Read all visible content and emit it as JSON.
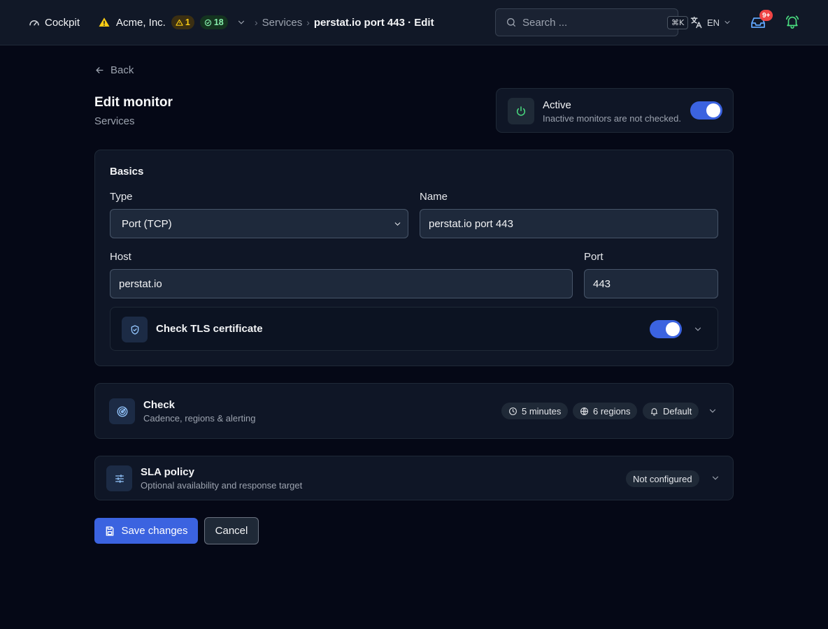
{
  "topbar": {
    "brand_label": "Cockpit",
    "org_name": "Acme, Inc.",
    "warning_count": "1",
    "ok_count": "18",
    "breadcrumb": {
      "parent": "Services",
      "current": "perstat.io port 443 · Edit"
    },
    "search": {
      "placeholder": "Search ...",
      "shortcut": "⌘K"
    },
    "language": "EN",
    "inbox_badge": "9+"
  },
  "page": {
    "back_label": "Back",
    "title": "Edit monitor",
    "subtitle": "Services"
  },
  "active_card": {
    "title": "Active",
    "description": "Inactive monitors are not checked.",
    "enabled": true
  },
  "basics": {
    "title": "Basics",
    "type_label": "Type",
    "type_value": "Port (TCP)",
    "name_label": "Name",
    "name_value": "perstat.io port 443",
    "host_label": "Host",
    "host_value": "perstat.io",
    "port_label": "Port",
    "port_value": "443",
    "tls_label": "Check TLS certificate",
    "tls_enabled": true
  },
  "check": {
    "title": "Check",
    "description": "Cadence, regions & alerting",
    "interval": "5 minutes",
    "regions": "6 regions",
    "alerting": "Default"
  },
  "sla": {
    "title": "SLA policy",
    "description": "Optional availability and response target",
    "status": "Not configured"
  },
  "actions": {
    "save_label": "Save changes",
    "cancel_label": "Cancel"
  },
  "colors": {
    "accent": "#3b63e0",
    "background": "#050816",
    "panel": "#0f1626",
    "warning": "#facc15",
    "success": "#86efac",
    "danger": "#ef4444"
  }
}
